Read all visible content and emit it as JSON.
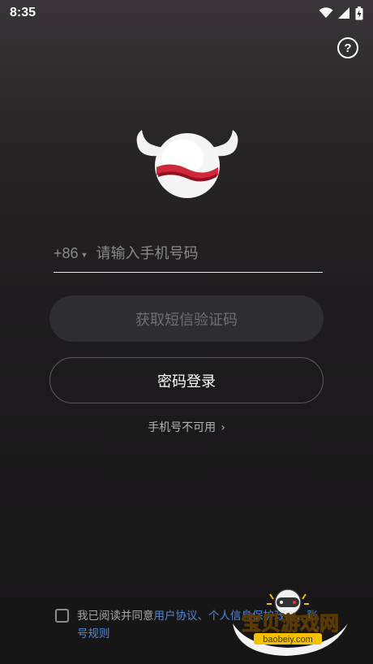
{
  "status_bar": {
    "time": "8:35",
    "icons": [
      "wifi-icon",
      "signal-icon",
      "battery-icon"
    ]
  },
  "help": {
    "label": "?"
  },
  "logo": {
    "name": "mascot-logo"
  },
  "phone": {
    "country_code": "+86",
    "placeholder": "请输入手机号码",
    "value": ""
  },
  "buttons": {
    "get_code": "获取短信验证码",
    "password_login": "密码登录"
  },
  "unavailable_link": {
    "label": "手机号不可用",
    "chevron": "›"
  },
  "agreement": {
    "prefix": "我已阅读并同意",
    "link_user": "用户协议、",
    "link_privacy": "个人信息保护政策",
    "sep": "、",
    "link_rules": "账号规则",
    "checked": false
  },
  "watermark": {
    "title": "宝贝游戏网",
    "url": "baobeiy.com"
  },
  "colors": {
    "accent_red": "#d0273a",
    "link_blue": "#4f8ad9",
    "watermark_yellow": "#f5c000"
  }
}
